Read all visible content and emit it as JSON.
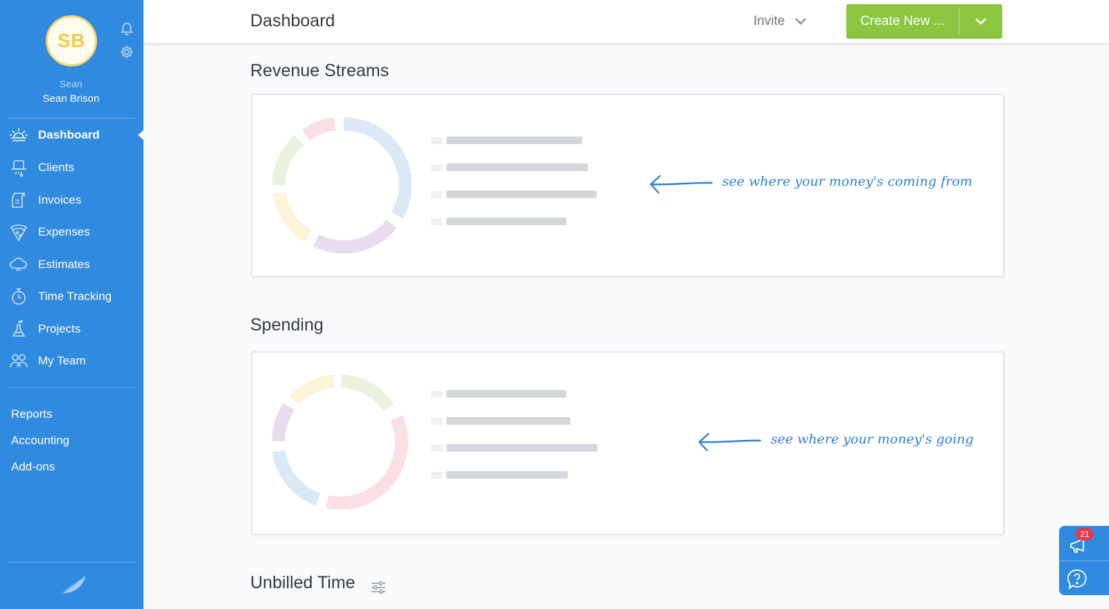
{
  "user": {
    "initials": "SB",
    "first_name": "Sean",
    "full_name": "Sean Brison"
  },
  "sidebar": {
    "nav": [
      {
        "label": "Dashboard",
        "icon": "sun-icon",
        "active": true
      },
      {
        "label": "Clients",
        "icon": "hat-icon"
      },
      {
        "label": "Invoices",
        "icon": "invoice-icon"
      },
      {
        "label": "Expenses",
        "icon": "pizza-icon"
      },
      {
        "label": "Estimates",
        "icon": "cloud-icon"
      },
      {
        "label": "Time Tracking",
        "icon": "stopwatch-icon"
      },
      {
        "label": "Projects",
        "icon": "flask-icon"
      },
      {
        "label": "My Team",
        "icon": "team-icon"
      }
    ],
    "secondary": [
      "Reports",
      "Accounting",
      "Add-ons"
    ]
  },
  "header": {
    "title": "Dashboard",
    "invite_label": "Invite",
    "create_label": "Create New ..."
  },
  "sections": {
    "revenue": {
      "title": "Revenue Streams",
      "hint": "see where your money's coming from"
    },
    "spending": {
      "title": "Spending",
      "hint": "see where your money's going"
    },
    "unbilled": {
      "title": "Unbilled Time"
    }
  },
  "widget": {
    "notification_count": "21"
  },
  "colors": {
    "sidebar": "#2f8ae0",
    "accent_green": "#8cc641",
    "hint_blue": "#2f7ed8",
    "badge_red": "#e53b4a"
  }
}
